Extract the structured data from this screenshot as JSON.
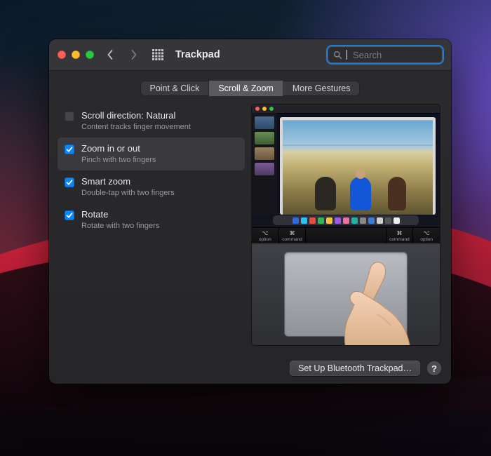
{
  "window": {
    "title": "Trackpad"
  },
  "toolbar": {
    "search_placeholder": "Search"
  },
  "tabs": [
    {
      "label": "Point & Click",
      "active": false
    },
    {
      "label": "Scroll & Zoom",
      "active": true
    },
    {
      "label": "More Gestures",
      "active": false
    }
  ],
  "options": [
    {
      "id": "scroll-direction",
      "title": "Scroll direction: Natural",
      "subtitle": "Content tracks finger movement",
      "checked": false,
      "selected": false
    },
    {
      "id": "zoom-in-out",
      "title": "Zoom in or out",
      "subtitle": "Pinch with two fingers",
      "checked": true,
      "selected": true
    },
    {
      "id": "smart-zoom",
      "title": "Smart zoom",
      "subtitle": "Double-tap with two fingers",
      "checked": true,
      "selected": false
    },
    {
      "id": "rotate",
      "title": "Rotate",
      "subtitle": "Rotate with two fingers",
      "checked": true,
      "selected": false
    }
  ],
  "keyboard_row": [
    {
      "sym": "⌥",
      "cap": "option"
    },
    {
      "sym": "⌘",
      "cap": "command"
    },
    {
      "sym": "",
      "cap": ""
    },
    {
      "sym": "⌘",
      "cap": "command"
    },
    {
      "sym": "⌥",
      "cap": "option"
    }
  ],
  "footer": {
    "setup_button": "Set Up Bluetooth Trackpad…",
    "help": "?"
  }
}
